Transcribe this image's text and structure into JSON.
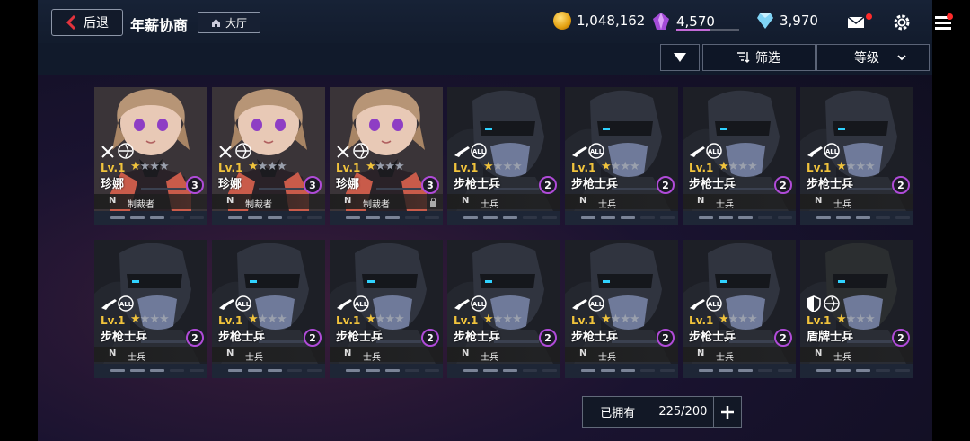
{
  "header": {
    "back_label": "后退",
    "title": "年薪协商",
    "hall_label": "大厅",
    "resources": {
      "gold": "1,048,162",
      "crystal": "4,570",
      "diamond": "3,970"
    }
  },
  "filters": {
    "filter_label": "筛选",
    "sort_label": "等级"
  },
  "owned": {
    "label": "已拥有",
    "value": "225/200"
  },
  "units": [
    {
      "name": "珍娜",
      "level": "Lv.1",
      "stars": 1,
      "count": "3",
      "rank": "N",
      "role": "制裁者",
      "type": "girl",
      "weapon": "blades",
      "locked": false
    },
    {
      "name": "珍娜",
      "level": "Lv.1",
      "stars": 1,
      "count": "3",
      "rank": "N",
      "role": "制裁者",
      "type": "girl",
      "weapon": "blades",
      "locked": false
    },
    {
      "name": "珍娜",
      "level": "Lv.1",
      "stars": 1,
      "count": "3",
      "rank": "N",
      "role": "制裁者",
      "type": "girl",
      "weapon": "blades",
      "locked": true
    },
    {
      "name": "步枪士兵",
      "level": "Lv.1",
      "stars": 1,
      "count": "2",
      "rank": "N",
      "role": "士兵",
      "type": "soldier",
      "weapon": "rifle",
      "locked": false
    },
    {
      "name": "步枪士兵",
      "level": "Lv.1",
      "stars": 1,
      "count": "2",
      "rank": "N",
      "role": "士兵",
      "type": "soldier",
      "weapon": "rifle",
      "locked": false
    },
    {
      "name": "步枪士兵",
      "level": "Lv.1",
      "stars": 1,
      "count": "2",
      "rank": "N",
      "role": "士兵",
      "type": "soldier",
      "weapon": "rifle",
      "locked": false
    },
    {
      "name": "步枪士兵",
      "level": "Lv.1",
      "stars": 1,
      "count": "2",
      "rank": "N",
      "role": "士兵",
      "type": "soldier",
      "weapon": "rifle",
      "locked": false
    },
    {
      "name": "步枪士兵",
      "level": "Lv.1",
      "stars": 1,
      "count": "2",
      "rank": "N",
      "role": "士兵",
      "type": "soldier",
      "weapon": "rifle",
      "locked": false
    },
    {
      "name": "步枪士兵",
      "level": "Lv.1",
      "stars": 1,
      "count": "2",
      "rank": "N",
      "role": "士兵",
      "type": "soldier",
      "weapon": "rifle",
      "locked": false
    },
    {
      "name": "步枪士兵",
      "level": "Lv.1",
      "stars": 1,
      "count": "2",
      "rank": "N",
      "role": "士兵",
      "type": "soldier",
      "weapon": "rifle",
      "locked": false
    },
    {
      "name": "步枪士兵",
      "level": "Lv.1",
      "stars": 1,
      "count": "2",
      "rank": "N",
      "role": "士兵",
      "type": "soldier",
      "weapon": "rifle",
      "locked": false
    },
    {
      "name": "步枪士兵",
      "level": "Lv.1",
      "stars": 1,
      "count": "2",
      "rank": "N",
      "role": "士兵",
      "type": "soldier",
      "weapon": "rifle",
      "locked": false
    },
    {
      "name": "步枪士兵",
      "level": "Lv.1",
      "stars": 1,
      "count": "2",
      "rank": "N",
      "role": "士兵",
      "type": "soldier",
      "weapon": "rifle",
      "locked": false
    },
    {
      "name": "盾牌士兵",
      "level": "Lv.1",
      "stars": 1,
      "count": "2",
      "rank": "N",
      "role": "士兵",
      "type": "heavy",
      "weapon": "shield",
      "locked": false
    }
  ]
}
